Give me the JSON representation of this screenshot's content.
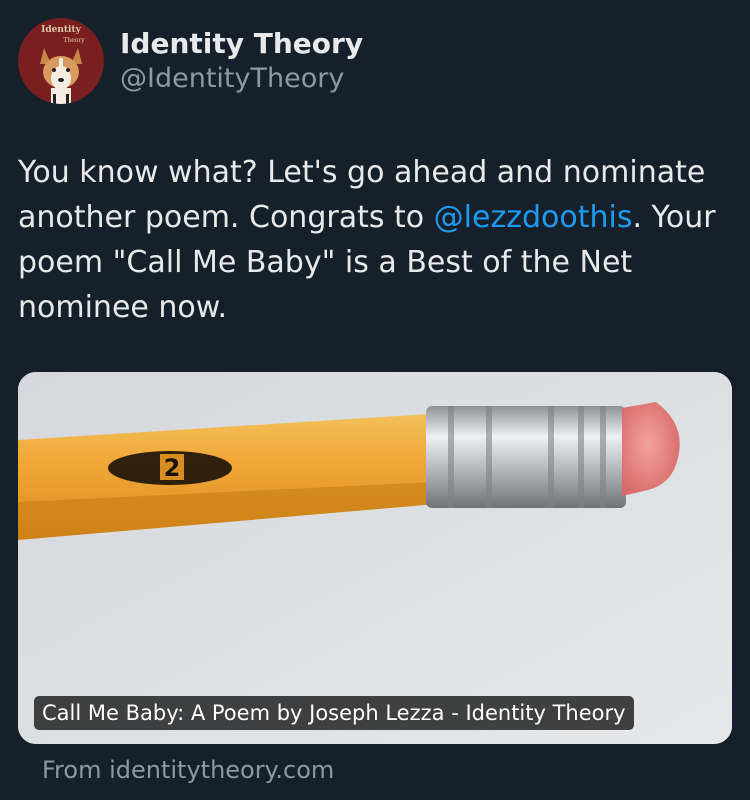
{
  "author": {
    "display_name": "Identity Theory",
    "handle": "@IdentityTheory",
    "avatar_text_top": "Identity",
    "avatar_text_bottom": "Theory"
  },
  "tweet": {
    "text_before_mention": "You know what? Let's go ahead and nominate another poem. Congrats to ",
    "mention": "@lezzdoothis",
    "text_after_mention": ". Your poem \"Call Me Baby\" is a Best of the Net nominee now."
  },
  "link_card": {
    "title": "Call Me Baby: A Poem by Joseph Lezza - Identity Theory",
    "pencil_number": "2",
    "source": "From identitytheory.com"
  },
  "colors": {
    "background": "#15202b",
    "text": "#e7e9ea",
    "secondary": "#8b98a5",
    "link": "#1d9bf0",
    "avatar_bg": "#7a1f1f"
  }
}
